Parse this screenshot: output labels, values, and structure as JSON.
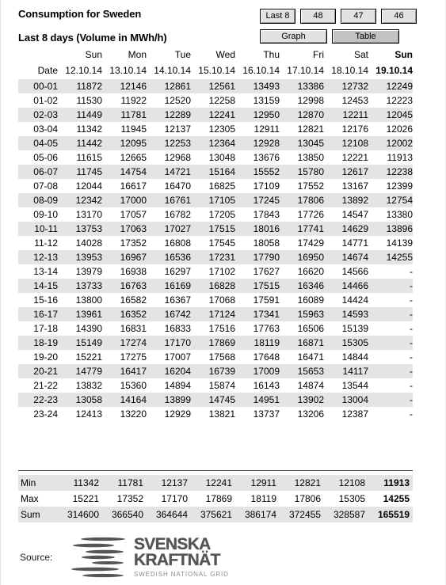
{
  "header": {
    "title": "Consumption for Sweden",
    "subtitle": "Last 8 days (Volume in MWh/h)",
    "week_buttons": [
      {
        "label": "Last 8",
        "active": false
      },
      {
        "label": "48",
        "active": false
      },
      {
        "label": "47",
        "active": false
      },
      {
        "label": "46",
        "active": false
      }
    ],
    "mode_buttons": [
      {
        "label": "Graph",
        "active": false
      },
      {
        "label": "Table",
        "active": true
      }
    ]
  },
  "table": {
    "row_label_header": "Date",
    "weekdays": [
      "Sun",
      "Mon",
      "Tue",
      "Wed",
      "Thu",
      "Fri",
      "Sat",
      "Sun"
    ],
    "dates": [
      "12.10.14",
      "13.10.14",
      "14.10.14",
      "15.10.14",
      "16.10.14",
      "17.10.14",
      "18.10.14",
      "19.10.14"
    ],
    "rows": [
      {
        "label": "00-01",
        "values": [
          "11872",
          "12146",
          "12861",
          "12561",
          "13493",
          "13386",
          "12732",
          "12249"
        ]
      },
      {
        "label": "01-02",
        "values": [
          "11530",
          "11922",
          "12520",
          "12258",
          "13159",
          "12998",
          "12453",
          "12223"
        ]
      },
      {
        "label": "02-03",
        "values": [
          "11449",
          "11781",
          "12289",
          "12241",
          "12950",
          "12870",
          "12211",
          "12045"
        ]
      },
      {
        "label": "03-04",
        "values": [
          "11342",
          "11945",
          "12137",
          "12305",
          "12911",
          "12821",
          "12176",
          "12026"
        ]
      },
      {
        "label": "04-05",
        "values": [
          "11442",
          "12095",
          "12253",
          "12364",
          "12928",
          "13045",
          "12108",
          "12002"
        ]
      },
      {
        "label": "05-06",
        "values": [
          "11615",
          "12665",
          "12968",
          "13048",
          "13676",
          "13850",
          "12221",
          "11913"
        ]
      },
      {
        "label": "06-07",
        "values": [
          "11745",
          "14754",
          "14721",
          "15164",
          "15552",
          "15780",
          "12617",
          "12238"
        ]
      },
      {
        "label": "07-08",
        "values": [
          "12044",
          "16617",
          "16470",
          "16825",
          "17109",
          "17552",
          "13167",
          "12399"
        ]
      },
      {
        "label": "08-09",
        "values": [
          "12342",
          "17000",
          "16761",
          "17105",
          "17245",
          "17806",
          "13892",
          "12754"
        ]
      },
      {
        "label": "09-10",
        "values": [
          "13170",
          "17057",
          "16782",
          "17205",
          "17843",
          "17726",
          "14547",
          "13380"
        ]
      },
      {
        "label": "10-11",
        "values": [
          "13753",
          "17063",
          "17027",
          "17515",
          "18016",
          "17741",
          "14629",
          "13896"
        ]
      },
      {
        "label": "11-12",
        "values": [
          "14028",
          "17352",
          "16808",
          "17545",
          "18058",
          "17429",
          "14771",
          "14139"
        ]
      },
      {
        "label": "12-13",
        "values": [
          "13953",
          "16967",
          "16536",
          "17231",
          "17790",
          "16950",
          "14674",
          "14255"
        ]
      },
      {
        "label": "13-14",
        "values": [
          "13979",
          "16938",
          "16297",
          "17102",
          "17627",
          "16620",
          "14566",
          "-"
        ]
      },
      {
        "label": "14-15",
        "values": [
          "13733",
          "16763",
          "16169",
          "16828",
          "17515",
          "16346",
          "14466",
          "-"
        ]
      },
      {
        "label": "15-16",
        "values": [
          "13800",
          "16582",
          "16367",
          "17068",
          "17591",
          "16089",
          "14424",
          "-"
        ]
      },
      {
        "label": "16-17",
        "values": [
          "13961",
          "16352",
          "16742",
          "17124",
          "17341",
          "15963",
          "14593",
          "-"
        ]
      },
      {
        "label": "17-18",
        "values": [
          "14390",
          "16831",
          "16833",
          "17516",
          "17763",
          "16506",
          "15139",
          "-"
        ]
      },
      {
        "label": "18-19",
        "values": [
          "15149",
          "17274",
          "17170",
          "17869",
          "18119",
          "16871",
          "15305",
          "-"
        ]
      },
      {
        "label": "19-20",
        "values": [
          "15221",
          "17275",
          "17007",
          "17568",
          "17648",
          "16471",
          "14844",
          "-"
        ]
      },
      {
        "label": "20-21",
        "values": [
          "14779",
          "16417",
          "16204",
          "16739",
          "17009",
          "15653",
          "14117",
          "-"
        ]
      },
      {
        "label": "21-22",
        "values": [
          "13832",
          "15360",
          "14894",
          "15874",
          "16143",
          "14874",
          "13544",
          "-"
        ]
      },
      {
        "label": "22-23",
        "values": [
          "13058",
          "14164",
          "13899",
          "14745",
          "14951",
          "13902",
          "13004",
          "-"
        ]
      },
      {
        "label": "23-24",
        "values": [
          "12413",
          "13220",
          "12929",
          "13821",
          "13737",
          "13206",
          "12387",
          "-"
        ]
      }
    ],
    "summary": [
      {
        "label": "Min",
        "values": [
          "11342",
          "11781",
          "12137",
          "12241",
          "12911",
          "12821",
          "12108",
          "11913"
        ]
      },
      {
        "label": "Max",
        "values": [
          "15221",
          "17352",
          "17170",
          "17869",
          "18119",
          "17806",
          "15305",
          "14255"
        ]
      },
      {
        "label": "Sum",
        "values": [
          "314600",
          "366540",
          "364644",
          "375621",
          "386174",
          "372455",
          "328587",
          "165519"
        ]
      }
    ]
  },
  "footer": {
    "source_label": "Source:",
    "logo_line1": "SVENSKA",
    "logo_line2": "KRAFTNÄT",
    "logo_line3": "SWEDISH NATIONAL GRID"
  },
  "colors": {
    "row_alt": "#e4e4e4",
    "button_face": "#e2e2e2",
    "button_active": "#c2c2c2",
    "logo_gray": "#555555",
    "separator": "#3a3a3a"
  },
  "chart_data": {
    "type": "table",
    "title": "Consumption for Sweden — Last 8 days (Volume in MWh/h)",
    "xlabel": "Date",
    "ylabel": "Volume (MWh/h)",
    "categories": [
      "00-01",
      "01-02",
      "02-03",
      "03-04",
      "04-05",
      "05-06",
      "06-07",
      "07-08",
      "08-09",
      "09-10",
      "10-11",
      "11-12",
      "12-13",
      "13-14",
      "14-15",
      "15-16",
      "16-17",
      "17-18",
      "18-19",
      "19-20",
      "20-21",
      "21-22",
      "22-23",
      "23-24"
    ],
    "series": [
      {
        "name": "12.10.14",
        "values": [
          11872,
          11530,
          11449,
          11342,
          11442,
          11615,
          11745,
          12044,
          12342,
          13170,
          13753,
          14028,
          13953,
          13979,
          13733,
          13800,
          13961,
          14390,
          15149,
          15221,
          14779,
          13832,
          13058,
          12413
        ]
      },
      {
        "name": "13.10.14",
        "values": [
          12146,
          11922,
          11781,
          11945,
          12095,
          12665,
          14754,
          16617,
          17000,
          17057,
          17063,
          17352,
          16967,
          16938,
          16763,
          16582,
          16352,
          16831,
          17274,
          17275,
          16417,
          15360,
          14164,
          13220
        ]
      },
      {
        "name": "14.10.14",
        "values": [
          12861,
          12520,
          12289,
          12137,
          12253,
          12968,
          14721,
          16470,
          16761,
          16782,
          17027,
          16808,
          16536,
          16297,
          16169,
          16367,
          16742,
          16833,
          17170,
          17007,
          16204,
          14894,
          13899,
          12929
        ]
      },
      {
        "name": "15.10.14",
        "values": [
          12561,
          12258,
          12241,
          12305,
          12364,
          13048,
          15164,
          16825,
          17105,
          17205,
          17515,
          17545,
          17231,
          17102,
          16828,
          17068,
          17124,
          17516,
          17869,
          17568,
          16739,
          15874,
          14745,
          13821
        ]
      },
      {
        "name": "16.10.14",
        "values": [
          13493,
          13159,
          12950,
          12911,
          12928,
          13676,
          15552,
          17109,
          17245,
          17843,
          18016,
          18058,
          17790,
          17627,
          17515,
          17591,
          17341,
          17763,
          18119,
          17648,
          17009,
          16143,
          14951,
          13737
        ]
      },
      {
        "name": "17.10.14",
        "values": [
          13386,
          12998,
          12870,
          12821,
          13045,
          13850,
          15780,
          17552,
          17806,
          17726,
          17741,
          17429,
          16950,
          16620,
          16346,
          16089,
          15963,
          16506,
          16871,
          16471,
          15653,
          14874,
          13902,
          13206
        ]
      },
      {
        "name": "18.10.14",
        "values": [
          12732,
          12453,
          12211,
          12176,
          12108,
          12221,
          12617,
          13167,
          13892,
          14547,
          14629,
          14771,
          14674,
          14566,
          14466,
          14424,
          14593,
          15139,
          15305,
          14844,
          14117,
          13544,
          13004,
          12387
        ]
      },
      {
        "name": "19.10.14",
        "values": [
          12249,
          12223,
          12045,
          12026,
          12002,
          11913,
          12238,
          12399,
          12754,
          13380,
          13896,
          14139,
          14255,
          null,
          null,
          null,
          null,
          null,
          null,
          null,
          null,
          null,
          null,
          null
        ]
      }
    ],
    "aggregates": {
      "Min": [
        11342,
        11781,
        12137,
        12241,
        12911,
        12821,
        12108,
        11913
      ],
      "Max": [
        15221,
        17352,
        17170,
        17869,
        18119,
        17806,
        15305,
        14255
      ],
      "Sum": [
        314600,
        366540,
        364644,
        375621,
        386174,
        372455,
        328587,
        165519
      ]
    },
    "grid": false,
    "legend": "top"
  }
}
